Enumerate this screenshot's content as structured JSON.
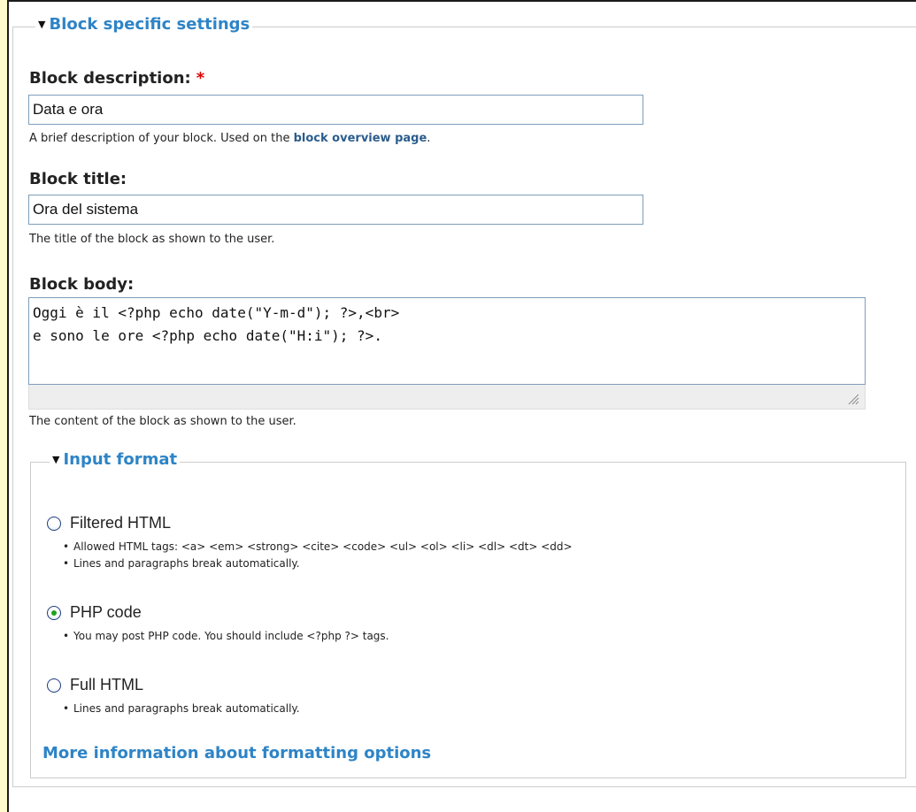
{
  "block_settings": {
    "legend": "Block specific settings",
    "description": {
      "label": "Block description:",
      "required_marker": "*",
      "value": "Data e ora",
      "help_prefix": "A brief description of your block. Used on the ",
      "help_link": "block overview page",
      "help_suffix": "."
    },
    "title": {
      "label": "Block title:",
      "value": "Ora del sistema",
      "help": "The title of the block as shown to the user."
    },
    "body": {
      "label": "Block body:",
      "value": "Oggi è il <?php echo date(\"Y-m-d\"); ?>,<br>\ne sono le ore <?php echo date(\"H:i\"); ?>.",
      "help": "The content of the block as shown to the user."
    }
  },
  "input_format": {
    "legend": "Input format",
    "options": [
      {
        "label": "Filtered HTML",
        "checked": false,
        "tips": [
          "Allowed HTML tags: <a> <em> <strong> <cite> <code> <ul> <ol> <li> <dl> <dt> <dd>",
          "Lines and paragraphs break automatically."
        ]
      },
      {
        "label": "PHP code",
        "checked": true,
        "tips": [
          "You may post PHP code. You should include <?php ?> tags."
        ]
      },
      {
        "label": "Full HTML",
        "checked": false,
        "tips": [
          "Lines and paragraphs break automatically."
        ]
      }
    ],
    "more_link": "More information about formatting options"
  },
  "colors": {
    "accent_link": "#2e84c6",
    "inline_link": "#2b5d8c",
    "required": "#e00000",
    "outer_background": "#fffbcc",
    "radio_checked": "#21a121"
  }
}
